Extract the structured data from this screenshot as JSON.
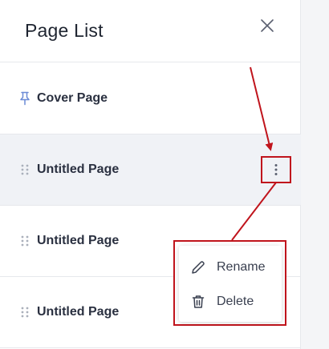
{
  "panel": {
    "title": "Page List",
    "close_icon": "close-icon"
  },
  "pages": [
    {
      "label": "Cover Page",
      "icon": "pin-icon"
    },
    {
      "label": "Untitled Page",
      "icon": "drag-handle-icon"
    },
    {
      "label": "Untitled Page",
      "icon": "drag-handle-icon"
    },
    {
      "label": "Untitled Page",
      "icon": "drag-handle-icon"
    }
  ],
  "context_menu": {
    "items": [
      {
        "label": "Rename",
        "icon": "pencil-icon"
      },
      {
        "label": "Delete",
        "icon": "trash-icon"
      }
    ]
  },
  "colors": {
    "annotation": "#c0141c",
    "selected_row": "#f0f2f6",
    "pin": "#6b8bd6"
  }
}
